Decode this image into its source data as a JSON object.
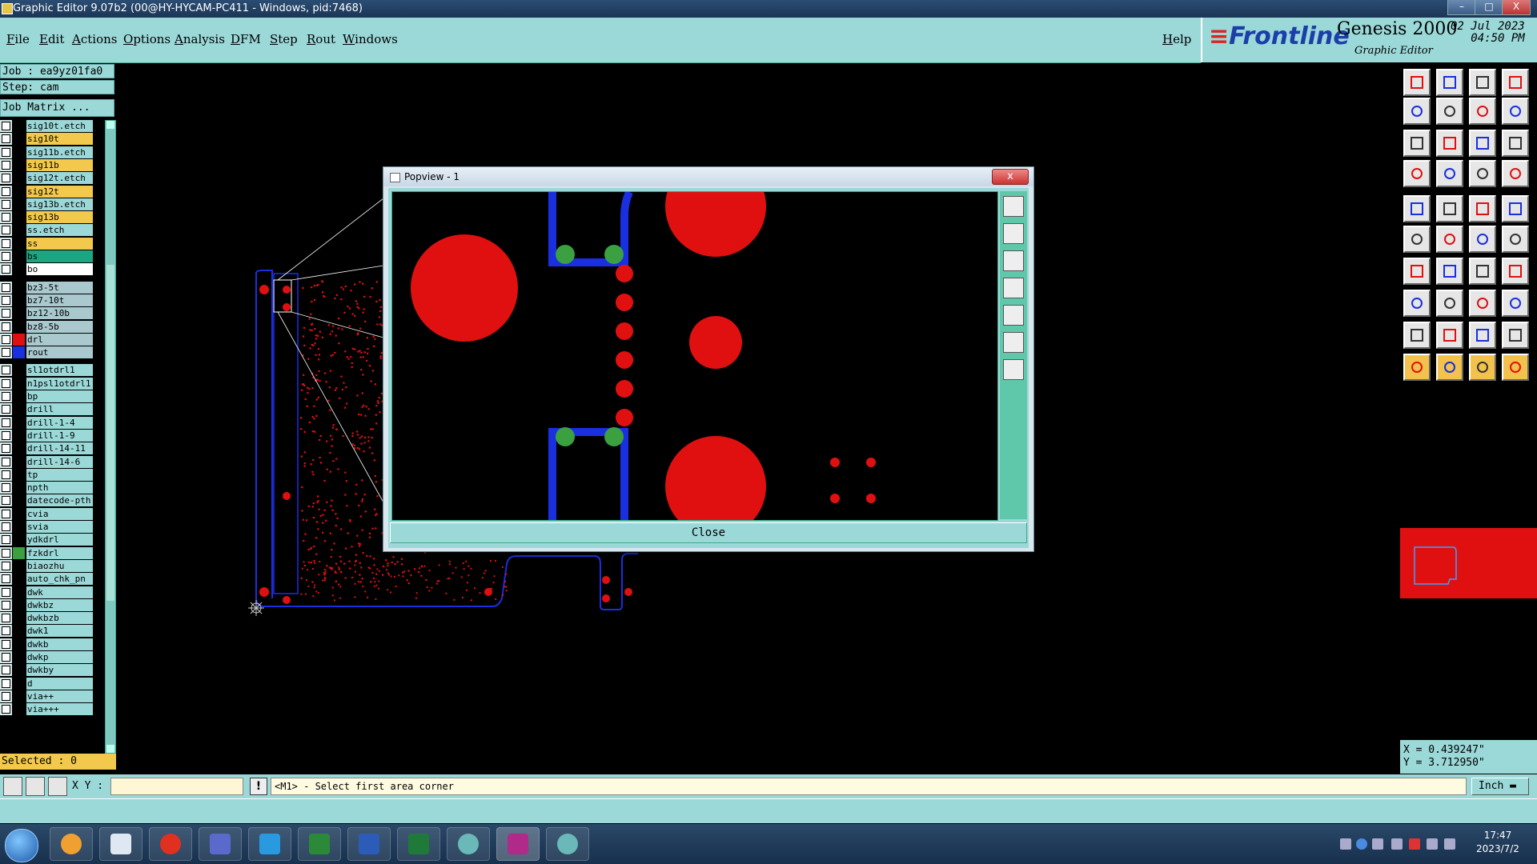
{
  "window": {
    "title": "Graphic Editor 9.07b2 (00@HY-HYCAM-PC411 - Windows, pid:7468)",
    "controls": [
      "–",
      "□",
      "X"
    ]
  },
  "menu": {
    "items": [
      "File",
      "Edit",
      "Actions",
      "Options",
      "Analysis",
      "DFM",
      "Step",
      "Rout",
      "Windows"
    ],
    "help": "Help"
  },
  "brand": {
    "logo": "Frontline",
    "product": "Genesis 2000",
    "subtitle": "Graphic Editor",
    "date": "02  Jul  2023",
    "time": "04:50  PM"
  },
  "job": {
    "job_line": "Job : ea9yz01fa0",
    "step_line": "Step: cam",
    "matrix_button": "Job Matrix ..."
  },
  "layers": [
    {
      "name": "sig10t.etch",
      "color": "#9bd8d8",
      "swatch": ""
    },
    {
      "name": "sig10t",
      "color": "#f2c94c",
      "swatch": ""
    },
    {
      "name": "sig11b.etch",
      "color": "#9bd8d8",
      "swatch": ""
    },
    {
      "name": "sig11b",
      "color": "#f2c94c",
      "swatch": ""
    },
    {
      "name": "sig12t.etch",
      "color": "#9bd8d8",
      "swatch": ""
    },
    {
      "name": "sig12t",
      "color": "#f2c94c",
      "swatch": ""
    },
    {
      "name": "sig13b.etch",
      "color": "#9bd8d8",
      "swatch": ""
    },
    {
      "name": "sig13b",
      "color": "#f2c94c",
      "swatch": ""
    },
    {
      "name": "ss.etch",
      "color": "#9bd8d8",
      "swatch": ""
    },
    {
      "name": "ss",
      "color": "#f2c94c",
      "swatch": ""
    },
    {
      "name": "bs",
      "color": "#1aa680",
      "swatch": ""
    },
    {
      "name": "bo",
      "color": "#ffffff",
      "swatch": ""
    },
    {
      "name": "bz3-5t",
      "color": "#a9c9cf",
      "swatch": ""
    },
    {
      "name": "bz7-10t",
      "color": "#a9c9cf",
      "swatch": ""
    },
    {
      "name": "bz12-10b",
      "color": "#a9c9cf",
      "swatch": ""
    },
    {
      "name": "bz8-5b",
      "color": "#a9c9cf",
      "swatch": ""
    },
    {
      "name": "drl",
      "color": "#a9c9cf",
      "swatch": "#e01010"
    },
    {
      "name": "rout",
      "color": "#a9c9cf",
      "swatch": "#1a2fe0"
    },
    {
      "name": "sl1otdrl1",
      "color": "#9bd8d8",
      "swatch": ""
    },
    {
      "name": "n1psl1otdrl1",
      "color": "#9bd8d8",
      "swatch": ""
    },
    {
      "name": "bp",
      "color": "#9bd8d8",
      "swatch": ""
    },
    {
      "name": "drill",
      "color": "#9bd8d8",
      "swatch": ""
    },
    {
      "name": "drill-1-4",
      "color": "#9bd8d8",
      "swatch": ""
    },
    {
      "name": "drill-1-9",
      "color": "#9bd8d8",
      "swatch": ""
    },
    {
      "name": "drill-14-11",
      "color": "#9bd8d8",
      "swatch": ""
    },
    {
      "name": "drill-14-6",
      "color": "#9bd8d8",
      "swatch": ""
    },
    {
      "name": "tp",
      "color": "#9bd8d8",
      "swatch": ""
    },
    {
      "name": "npth",
      "color": "#9bd8d8",
      "swatch": ""
    },
    {
      "name": "datecode-pth",
      "color": "#9bd8d8",
      "swatch": ""
    },
    {
      "name": "cvia",
      "color": "#9bd8d8",
      "swatch": ""
    },
    {
      "name": "svia",
      "color": "#9bd8d8",
      "swatch": ""
    },
    {
      "name": "ydkdrl",
      "color": "#9bd8d8",
      "swatch": ""
    },
    {
      "name": "fzkdrl",
      "color": "#9bd8d8",
      "swatch": "#3aa040"
    },
    {
      "name": "biaozhu",
      "color": "#9bd8d8",
      "swatch": ""
    },
    {
      "name": "auto_chk_pn",
      "color": "#9bd8d8",
      "swatch": ""
    },
    {
      "name": "dwk",
      "color": "#9bd8d8",
      "swatch": ""
    },
    {
      "name": "dwkbz",
      "color": "#9bd8d8",
      "swatch": ""
    },
    {
      "name": "dwkbzb",
      "color": "#9bd8d8",
      "swatch": ""
    },
    {
      "name": "dwk1",
      "color": "#9bd8d8",
      "swatch": ""
    },
    {
      "name": "dwkb",
      "color": "#9bd8d8",
      "swatch": ""
    },
    {
      "name": "dwkp",
      "color": "#9bd8d8",
      "swatch": ""
    },
    {
      "name": "dwkby",
      "color": "#9bd8d8",
      "swatch": ""
    },
    {
      "name": "d",
      "color": "#9bd8d8",
      "swatch": ""
    },
    {
      "name": "via++",
      "color": "#9bd8d8",
      "swatch": ""
    },
    {
      "name": "via+++",
      "color": "#9bd8d8",
      "swatch": ""
    }
  ],
  "selected": "Selected : 0",
  "popview": {
    "title": "Popview - 1",
    "close_label": "Close",
    "title_close": "x"
  },
  "coords": {
    "x": "X = 0.439247\"",
    "y": "Y = 3.712950\""
  },
  "command": {
    "xy_label": "X Y :",
    "xy_value": "",
    "prompt": "<M1> - Select first area corner",
    "units": "Inch"
  },
  "taskbar": {
    "time": "17:47",
    "date": "2023/7/2"
  },
  "colors": {
    "panel": "#9bd8d8",
    "pad_red": "#e01010",
    "trace_blue": "#1a2fe0",
    "via_green": "#3aa040",
    "highlight": "#f2c94c"
  }
}
